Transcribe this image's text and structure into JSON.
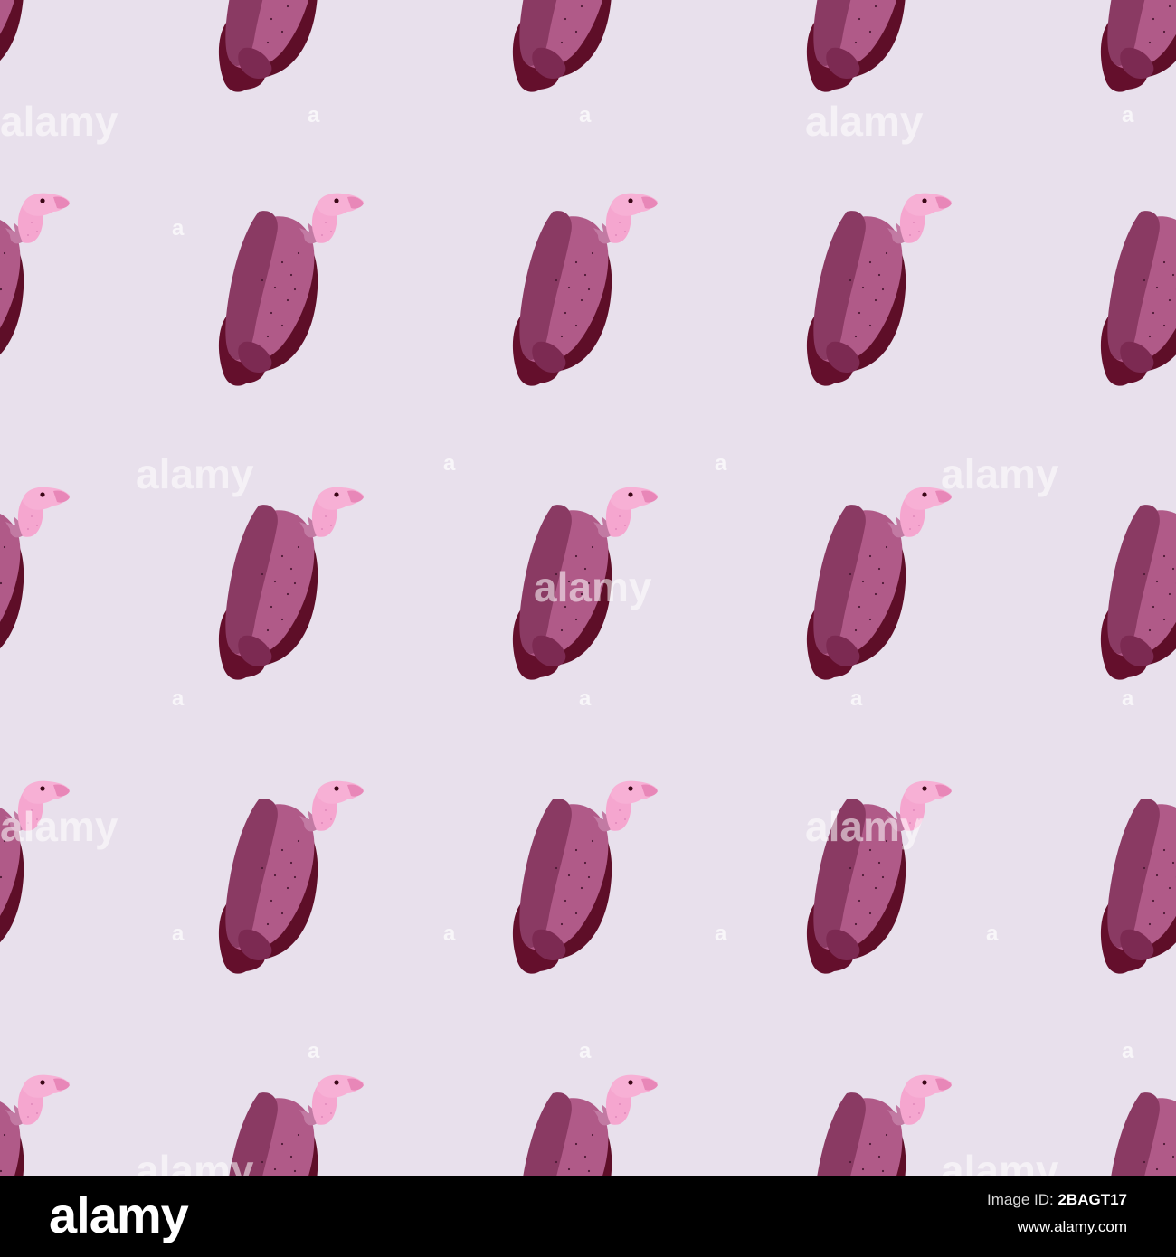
{
  "image": {
    "subject": "vulture-pattern",
    "background_color": "#e8e0ec"
  },
  "watermark": {
    "text": "alamy",
    "short_text": "a",
    "color": "#ffffff"
  },
  "footer": {
    "logo": "alamy",
    "image_id_label": "Image ID:",
    "image_id": "2BAGT17",
    "site": "www.alamy.com"
  }
}
